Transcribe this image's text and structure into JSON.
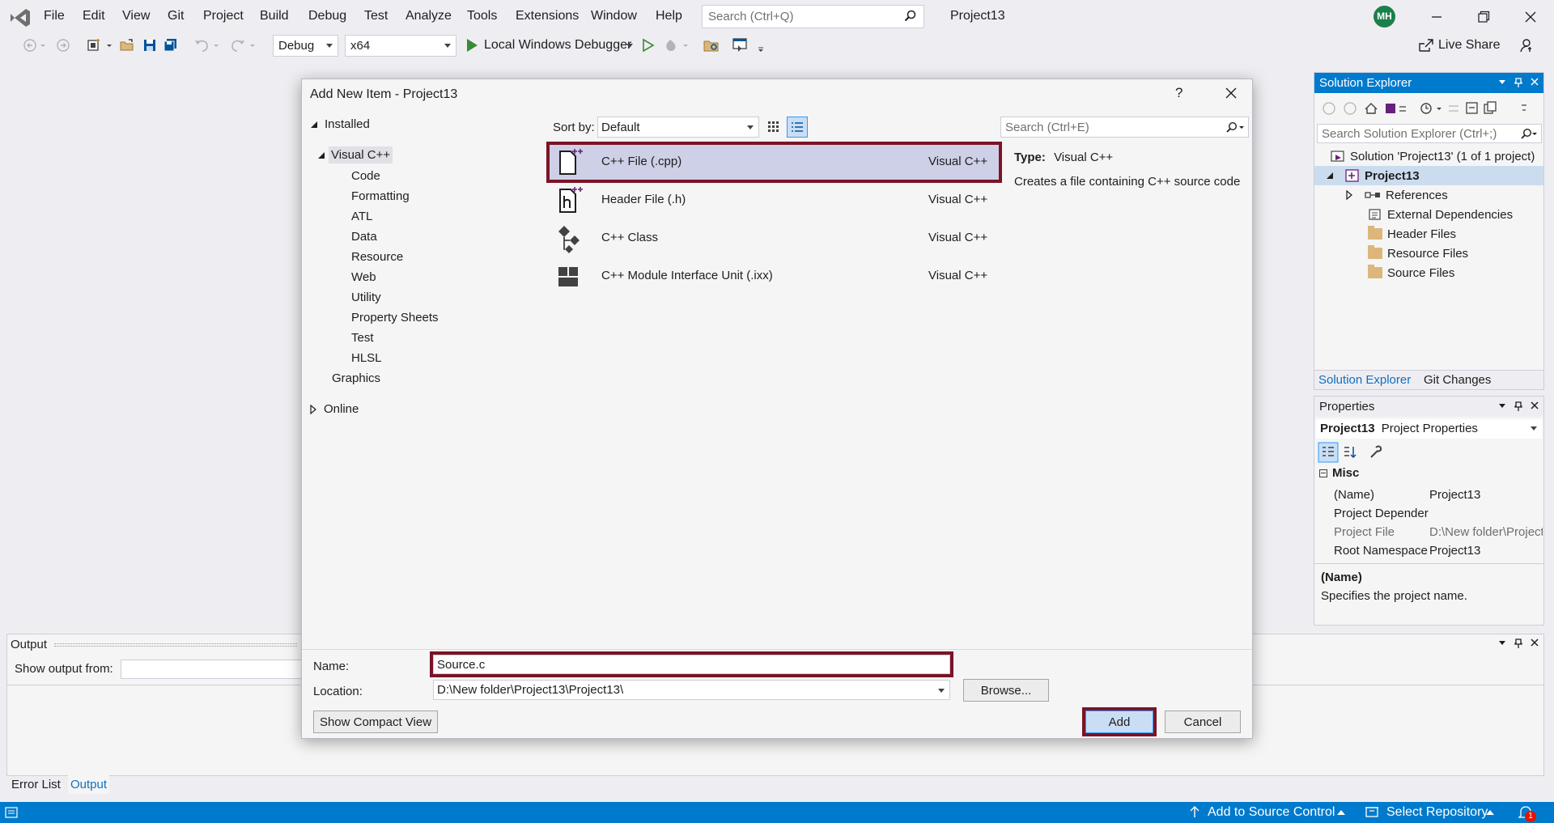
{
  "menu": {
    "items": [
      "File",
      "Edit",
      "View",
      "Git",
      "Project",
      "Build",
      "Debug",
      "Test",
      "Analyze",
      "Tools",
      "Extensions",
      "Window",
      "Help"
    ],
    "search_placeholder": "Search (Ctrl+Q)",
    "window_title": "Project13",
    "avatar_initials": "MH"
  },
  "toolbar": {
    "configuration": "Debug",
    "platform": "x64",
    "run_target": "Local Windows Debugger",
    "live_share": "Live Share"
  },
  "solution_explorer": {
    "title": "Solution Explorer",
    "search_placeholder": "Search Solution Explorer (Ctrl+;)",
    "solution": "Solution 'Project13' (1 of 1 project)",
    "project": "Project13",
    "nodes": [
      "References",
      "External Dependencies",
      "Header Files",
      "Resource Files",
      "Source Files"
    ],
    "tabs": [
      "Solution Explorer",
      "Git Changes"
    ]
  },
  "properties": {
    "title": "Properties",
    "object_name": "Project13",
    "object_type": "Project Properties",
    "section": "Misc",
    "rows": [
      {
        "key": "(Name)",
        "value": "Project13"
      },
      {
        "key": "Project Depender",
        "value": ""
      },
      {
        "key": "Project File",
        "value": "D:\\New folder\\Project"
      },
      {
        "key": "Root Namespace",
        "value": "Project13"
      }
    ],
    "desc_title": "(Name)",
    "desc_text": "Specifies the project name."
  },
  "output": {
    "title": "Output",
    "show_from_label": "Show output from:"
  },
  "bottom_tabs": [
    "Error List",
    "Output"
  ],
  "statusbar": {
    "source_control": "Add to Source Control",
    "repository": "Select Repository",
    "notifications": "1"
  },
  "dialog": {
    "title": "Add New Item - Project13",
    "help": "?",
    "tree": {
      "installed": "Installed",
      "visual_cpp": "Visual C++",
      "children": [
        "Code",
        "Formatting",
        "ATL",
        "Data",
        "Resource",
        "Web",
        "Utility",
        "Property Sheets",
        "Test",
        "HLSL"
      ],
      "graphics": "Graphics",
      "online": "Online"
    },
    "sort_label": "Sort by:",
    "sort_value": "Default",
    "search_placeholder": "Search (Ctrl+E)",
    "templates": [
      {
        "name": "C++ File (.cpp)",
        "lang": "Visual C++"
      },
      {
        "name": "Header File (.h)",
        "lang": "Visual C++"
      },
      {
        "name": "C++ Class",
        "lang": "Visual C++"
      },
      {
        "name": "C++ Module Interface Unit (.ixx)",
        "lang": "Visual C++"
      }
    ],
    "type_label": "Type:",
    "type_value": "Visual C++",
    "description": "Creates a file containing C++ source code",
    "name_label": "Name:",
    "name_value": "Source.c",
    "location_label": "Location:",
    "location_value": "D:\\New folder\\Project13\\Project13\\",
    "browse_label": "Browse...",
    "compact_label": "Show Compact View",
    "add_label": "Add",
    "cancel_label": "Cancel",
    "highlight_color": "#7a1426"
  }
}
